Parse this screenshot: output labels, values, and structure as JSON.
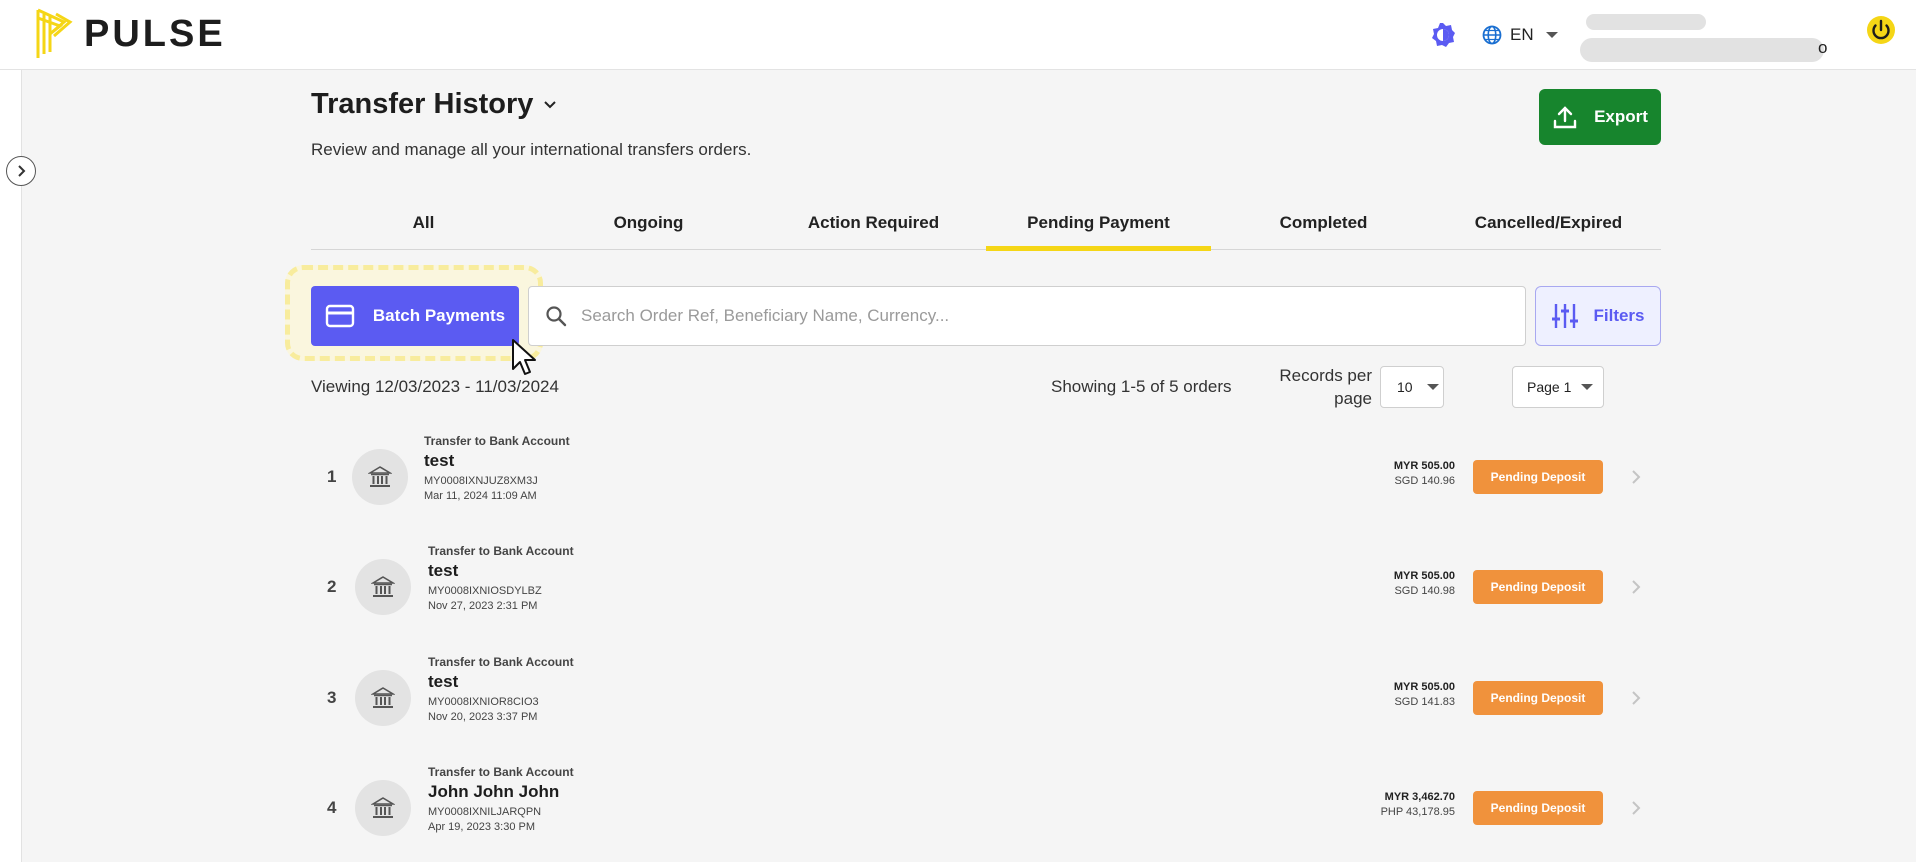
{
  "header": {
    "logo_text": "PULSE",
    "language": "EN",
    "user_suffix": "o"
  },
  "page": {
    "title": "Transfer History",
    "subtitle": "Review and manage all your international transfers orders.",
    "export_label": "Export"
  },
  "tabs": [
    {
      "label": "All",
      "active": false
    },
    {
      "label": "Ongoing",
      "active": false
    },
    {
      "label": "Action Required",
      "active": false
    },
    {
      "label": "Pending Payment",
      "active": true
    },
    {
      "label": "Completed",
      "active": false
    },
    {
      "label": "Cancelled/Expired",
      "active": false
    }
  ],
  "toolbar": {
    "batch_label": "Batch Payments",
    "search_placeholder": "Search Order Ref, Beneficiary Name, Currency...",
    "filters_label": "Filters"
  },
  "summary": {
    "viewing": "Viewing 12/03/2023 - 11/03/2024",
    "showing": "Showing 1-5 of 5 orders",
    "records_per_page_label": "Records per page",
    "records_per_page": "10",
    "page": "Page 1"
  },
  "orders": [
    {
      "num": "1",
      "type": "Transfer to Bank Account",
      "name": "test",
      "ref": "MY0008IXNJUZ8XM3J",
      "date": "Mar 11, 2024 11:09 AM",
      "amount": "MYR 505.00",
      "converted": "SGD 140.96",
      "status": "Pending Deposit"
    },
    {
      "num": "2",
      "type": "Transfer to Bank Account",
      "name": "test",
      "ref": "MY0008IXNIOSDYLBZ",
      "date": "Nov 27, 2023 2:31 PM",
      "amount": "MYR 505.00",
      "converted": "SGD 140.98",
      "status": "Pending Deposit"
    },
    {
      "num": "3",
      "type": "Transfer to Bank Account",
      "name": "test",
      "ref": "MY0008IXNIOR8CIO3",
      "date": "Nov 20, 2023 3:37 PM",
      "amount": "MYR 505.00",
      "converted": "SGD 141.83",
      "status": "Pending Deposit"
    },
    {
      "num": "4",
      "type": "Transfer to Bank Account",
      "name": "John John John",
      "ref": "MY0008IXNILJARQPN",
      "date": "Apr 19, 2023 3:30 PM",
      "amount": "MYR 3,462.70",
      "converted": "PHP 43,178.95",
      "status": "Pending Deposit"
    }
  ],
  "colors": {
    "brand_yellow": "#f5d616",
    "primary": "#5b5bf2",
    "export_green": "#17852d",
    "status_orange": "#f0923c"
  },
  "icons": {
    "theme": "theme-toggle-icon",
    "language": "globe-icon",
    "power": "power-icon",
    "sidebar": "chevron-right-circle-icon",
    "export": "upload-icon",
    "batch": "credit-card-icon",
    "search": "search-icon",
    "filters": "sliders-icon",
    "row": "bank-icon"
  }
}
